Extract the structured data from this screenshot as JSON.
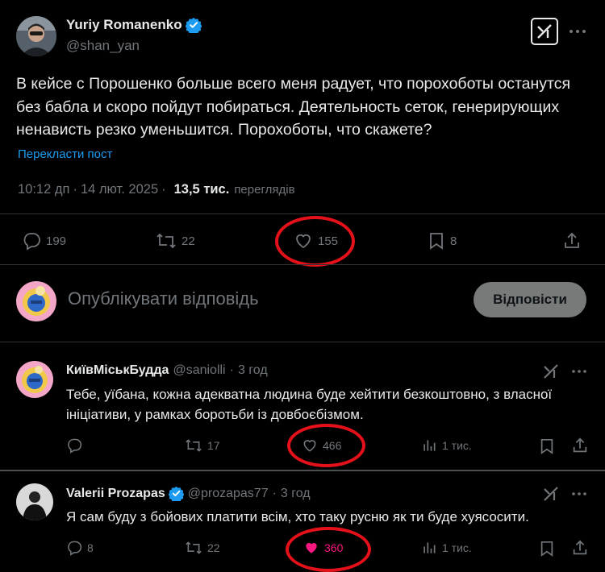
{
  "post": {
    "author_name": "Yuriy Romanenko",
    "author_handle": "@shan_yan",
    "text": "В кейсе с Порошенко больше всего меня радует, что порохоботы останутся без бабла и скоро пойдут побираться. Деятельность сеток, генерирующих ненависть резко уменьшится. Порохоботы, что скажете?",
    "translate_label": "Перекласти пост",
    "time": "10:12 дп",
    "date": "14 лют. 2025",
    "views": "13,5 тис.",
    "views_label": "переглядів",
    "separator": "·",
    "stats": {
      "replies": "199",
      "reposts": "22",
      "likes": "155",
      "bookmarks": "8"
    }
  },
  "composer": {
    "placeholder": "Опублікувати відповідь",
    "button_label": "Відповісти"
  },
  "replies": [
    {
      "author_name": "КиївМіськБудда",
      "author_handle": "@saniolli",
      "dot": "·",
      "time": "3 год",
      "text": "Тебе, уїбана, кожна адекватна людина буде хейтити безкоштовно, з власної ініціативи, у рамках боротьби із довбоєбізмом.",
      "stats": {
        "replies": "",
        "reposts": "17",
        "likes": "466",
        "views": "1 тис."
      }
    },
    {
      "author_name": "Valerii Prozapas",
      "author_handle": "@prozapas77",
      "dot": "·",
      "time": "3 год",
      "text": "Я сам буду з бойових платити всім, хто таку русню як ти буде хуясосити.",
      "stats": {
        "replies": "8",
        "reposts": "22",
        "likes": "360",
        "views": "1 тис."
      }
    }
  ],
  "colors": {
    "background": "#000000",
    "text": "#e7e9ea",
    "muted": "#71767b",
    "link": "#1d9bf0",
    "verified": "#1d9bf0",
    "liked": "#f91880",
    "annotation": "#e4111a"
  },
  "icons": [
    "verified-badge-icon",
    "grok-icon",
    "more-icon",
    "reply-icon",
    "repost-icon",
    "like-icon",
    "bookmark-icon",
    "share-icon",
    "views-icon"
  ]
}
